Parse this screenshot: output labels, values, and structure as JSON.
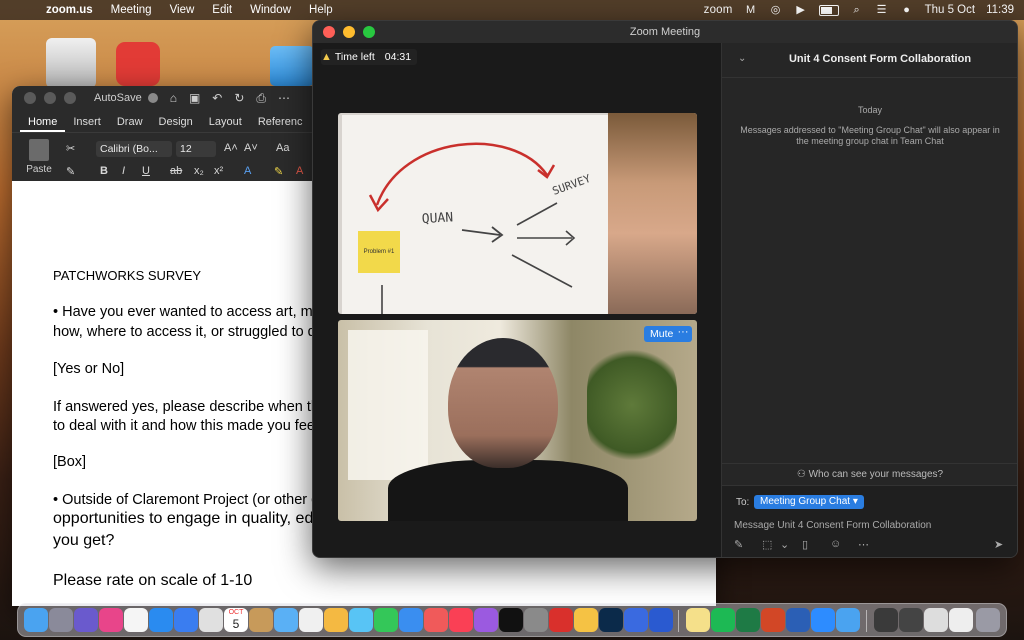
{
  "menubar": {
    "app_name": "zoom.us",
    "menus": [
      "Meeting",
      "View",
      "Edit",
      "Window",
      "Help"
    ],
    "right_app": "zoom",
    "date": "Thu 5 Oct",
    "time": "11:39"
  },
  "word": {
    "autosave_label": "AutoSave",
    "tabs": [
      "Home",
      "Insert",
      "Draw",
      "Design",
      "Layout",
      "Referenc"
    ],
    "paste_label": "Paste",
    "font_name": "Calibri (Bo...",
    "font_size": "12",
    "document": {
      "lines": [
        "PATCHWORKS SURVEY",
        "• Have you ever wanted to access art, mus",
        "how, where to access it, or struggled to do",
        "[Yes or No]",
        "If answered yes, please describe when this",
        "to deal with it and how this made you feel",
        "[Box]",
        "• Outside of Claremont Project (or other c",
        "opportunities to engage in quality, edu",
        "you get?",
        "Please rate on scale of 1-10"
      ]
    }
  },
  "zoom": {
    "window_title": "Zoom Meeting",
    "time_left_label": "Time left",
    "time_left_value": "04:31",
    "whiteboard": {
      "words": [
        "QUAN",
        "SURVEY"
      ],
      "sticky_note": "Problem #1"
    },
    "mute_label": "Mute",
    "more_label": "···",
    "chat": {
      "title": "Unit 4 Consent Form Collaboration",
      "today_label": "Today",
      "notice": "Messages addressed to \"Meeting Group Chat\" will also appear in the meeting group chat in Team Chat",
      "who_can_see": "Who can see your messages?",
      "to_label": "To:",
      "to_value": "Meeting Group Chat",
      "message_placeholder": "Message Unit 4 Consent Form Collaboration"
    }
  },
  "dock": {
    "calendar_month": "OCT",
    "calendar_day": "5"
  }
}
